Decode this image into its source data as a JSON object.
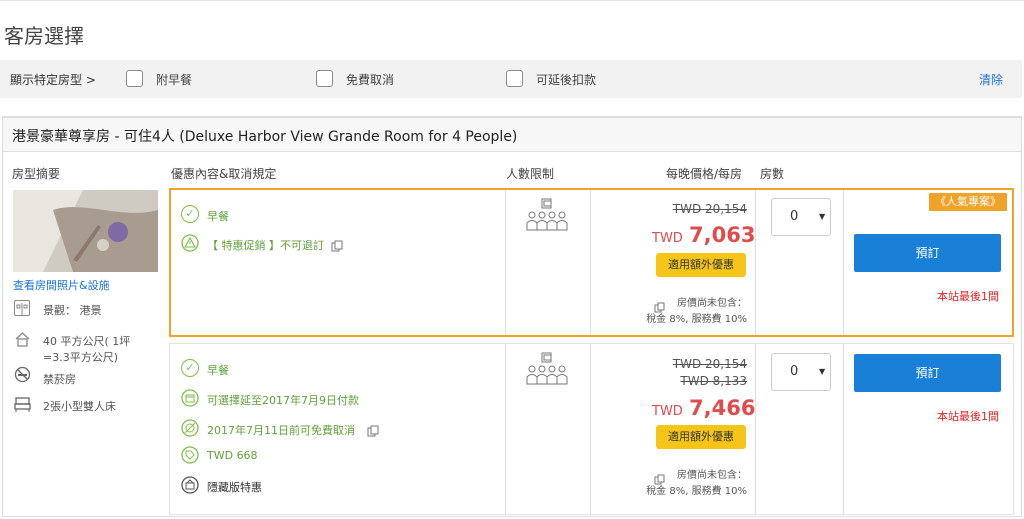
{
  "page": {
    "title": "客房選擇"
  },
  "filters": {
    "label": "顯示特定房型 >",
    "options": [
      {
        "label": "附早餐"
      },
      {
        "label": "免費取消"
      },
      {
        "label": "可延後扣款"
      }
    ],
    "clear": "清除"
  },
  "room": {
    "title": "港景豪華尊享房 - 可住4人 (Deluxe Harbor View Grande Room for 4 People)",
    "columns": {
      "summary": "房型摘要",
      "offer": "優惠內容&取消規定",
      "occupancy": "人數限制",
      "price": "每晚價格/每房",
      "rooms": "房數"
    },
    "photo_link": "查看房間照片&設施",
    "features": [
      {
        "icon": "view-icon",
        "text": "景觀： 港景"
      },
      {
        "icon": "house-icon",
        "text": "40 平方公尺( 1坪 =3.3平方公尺)"
      },
      {
        "icon": "no-smoking-icon",
        "text": "禁菸房"
      },
      {
        "icon": "bed-icon",
        "text": "2張小型雙人床"
      }
    ]
  },
  "offers": [
    {
      "badge": "《人氣專案》",
      "items": [
        {
          "icon": "check-icon",
          "text": "早餐"
        },
        {
          "icon": "warning-icon",
          "text": "【 特惠促銷 】不可退訂"
        }
      ],
      "original_price": "TWD 20,154",
      "currency": "TWD",
      "price": "7,063",
      "promo_button": "適用額外優惠",
      "note_line1": "房價尚未包含：",
      "note_line2": "稅金 8%, 服務費 10%",
      "rooms_selected": "0",
      "book_button": "預訂",
      "availability": "本站最後1間"
    },
    {
      "items": [
        {
          "icon": "check-icon",
          "text": "早餐"
        },
        {
          "icon": "calendar-icon",
          "text": "可選擇延至2017年7月9日付款"
        },
        {
          "icon": "cancel-icon",
          "text": "2017年7月11日前可免費取消"
        },
        {
          "icon": "tag-icon",
          "text": "TWD 668"
        },
        {
          "icon": "hidden-deal-icon",
          "text": "隱藏版特惠"
        }
      ],
      "original_price": "TWD 20,154",
      "original_price2": "TWD 8,133",
      "currency": "TWD",
      "price": "7,466",
      "promo_button": "適用額外優惠",
      "note_line1": "房價尚未包含：",
      "note_line2": "稅金 8%, 服務費 10%",
      "rooms_selected": "0",
      "book_button": "預訂",
      "availability": "本站最後1間"
    }
  ]
}
